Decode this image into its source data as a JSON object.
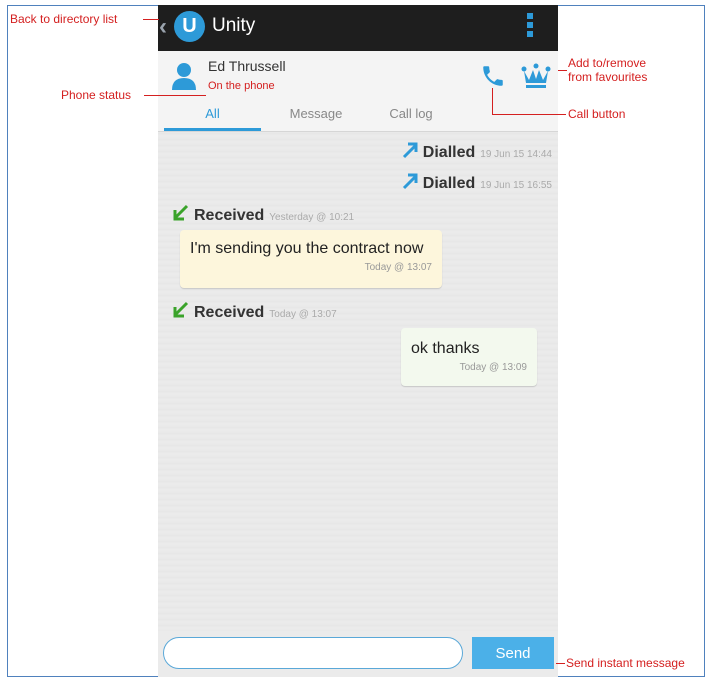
{
  "app": {
    "title": "Unity",
    "logo_letter": "U"
  },
  "contact": {
    "name": "Ed Thrussell",
    "status": "On the phone"
  },
  "tabs": [
    {
      "label": "All",
      "active": true
    },
    {
      "label": "Message",
      "active": false
    },
    {
      "label": "Call log",
      "active": false
    }
  ],
  "entries": [
    {
      "type": "call",
      "direction": "dialled",
      "label": "Dialled",
      "time": "19 Jun 15 14:44"
    },
    {
      "type": "call",
      "direction": "dialled",
      "label": "Dialled",
      "time": "19 Jun 15 16:55"
    },
    {
      "type": "call",
      "direction": "received",
      "label": "Received",
      "time": "Yesterday @ 10:21"
    },
    {
      "type": "message",
      "direction": "incoming",
      "text": "I'm sending you the contract now",
      "time": "Today @ 13:07"
    },
    {
      "type": "call",
      "direction": "received",
      "label": "Received",
      "time": "Today @ 13:07"
    },
    {
      "type": "message",
      "direction": "outgoing",
      "text": "ok thanks",
      "time": "Today @ 13:09"
    }
  ],
  "composer": {
    "placeholder": "",
    "send_label": "Send"
  },
  "annotations": {
    "back": "Back to directory list",
    "phone_status": "Phone status",
    "favourites_line1": "Add to/remove",
    "favourites_line2": "from favourites",
    "call_button": "Call button",
    "send": "Send instant message"
  },
  "colors": {
    "accent": "#2d9ad8",
    "topbar": "#1e1e1e",
    "annotation": "#d42020",
    "received_arrow": "#3aa32a",
    "incoming_bubble": "#fdf6dc",
    "outgoing_bubble": "#f3f9ee"
  },
  "icons": [
    "back-chevron-icon",
    "unity-logo-icon",
    "overflow-menu-icon",
    "person-icon",
    "phone-icon",
    "crown-icon",
    "dialled-arrow-icon",
    "received-arrow-icon"
  ]
}
